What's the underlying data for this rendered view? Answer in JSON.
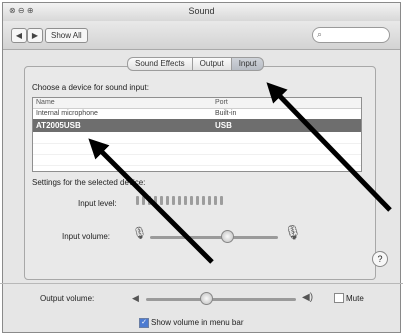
{
  "window": {
    "title": "Sound",
    "lights": "⊗ ⊖ ⊕"
  },
  "toolbar": {
    "back": "◀",
    "forward": "▶",
    "show_all": "Show All",
    "search_placeholder": ""
  },
  "tabs": [
    {
      "label": "Sound Effects",
      "active": false
    },
    {
      "label": "Output",
      "active": false
    },
    {
      "label": "Input",
      "active": true
    }
  ],
  "input": {
    "choose_label": "Choose a device for sound input:",
    "columns": [
      "Name",
      "Port"
    ],
    "devices": [
      {
        "name": "Internal microphone",
        "port": "Built-in"
      },
      {
        "name": "AT2005USB",
        "port": "USB",
        "selected": true
      }
    ],
    "settings_label": "Settings for the selected device:",
    "input_level_label": "Input level:",
    "input_level_segments": 15,
    "input_volume_label": "Input volume:",
    "input_volume_fraction": 0.6
  },
  "output": {
    "output_volume_label": "Output volume:",
    "output_volume_fraction": 0.4,
    "mute_label": "Mute",
    "show_volume_label": "Show volume in menu bar",
    "show_volume_checked": true
  },
  "help": "?"
}
